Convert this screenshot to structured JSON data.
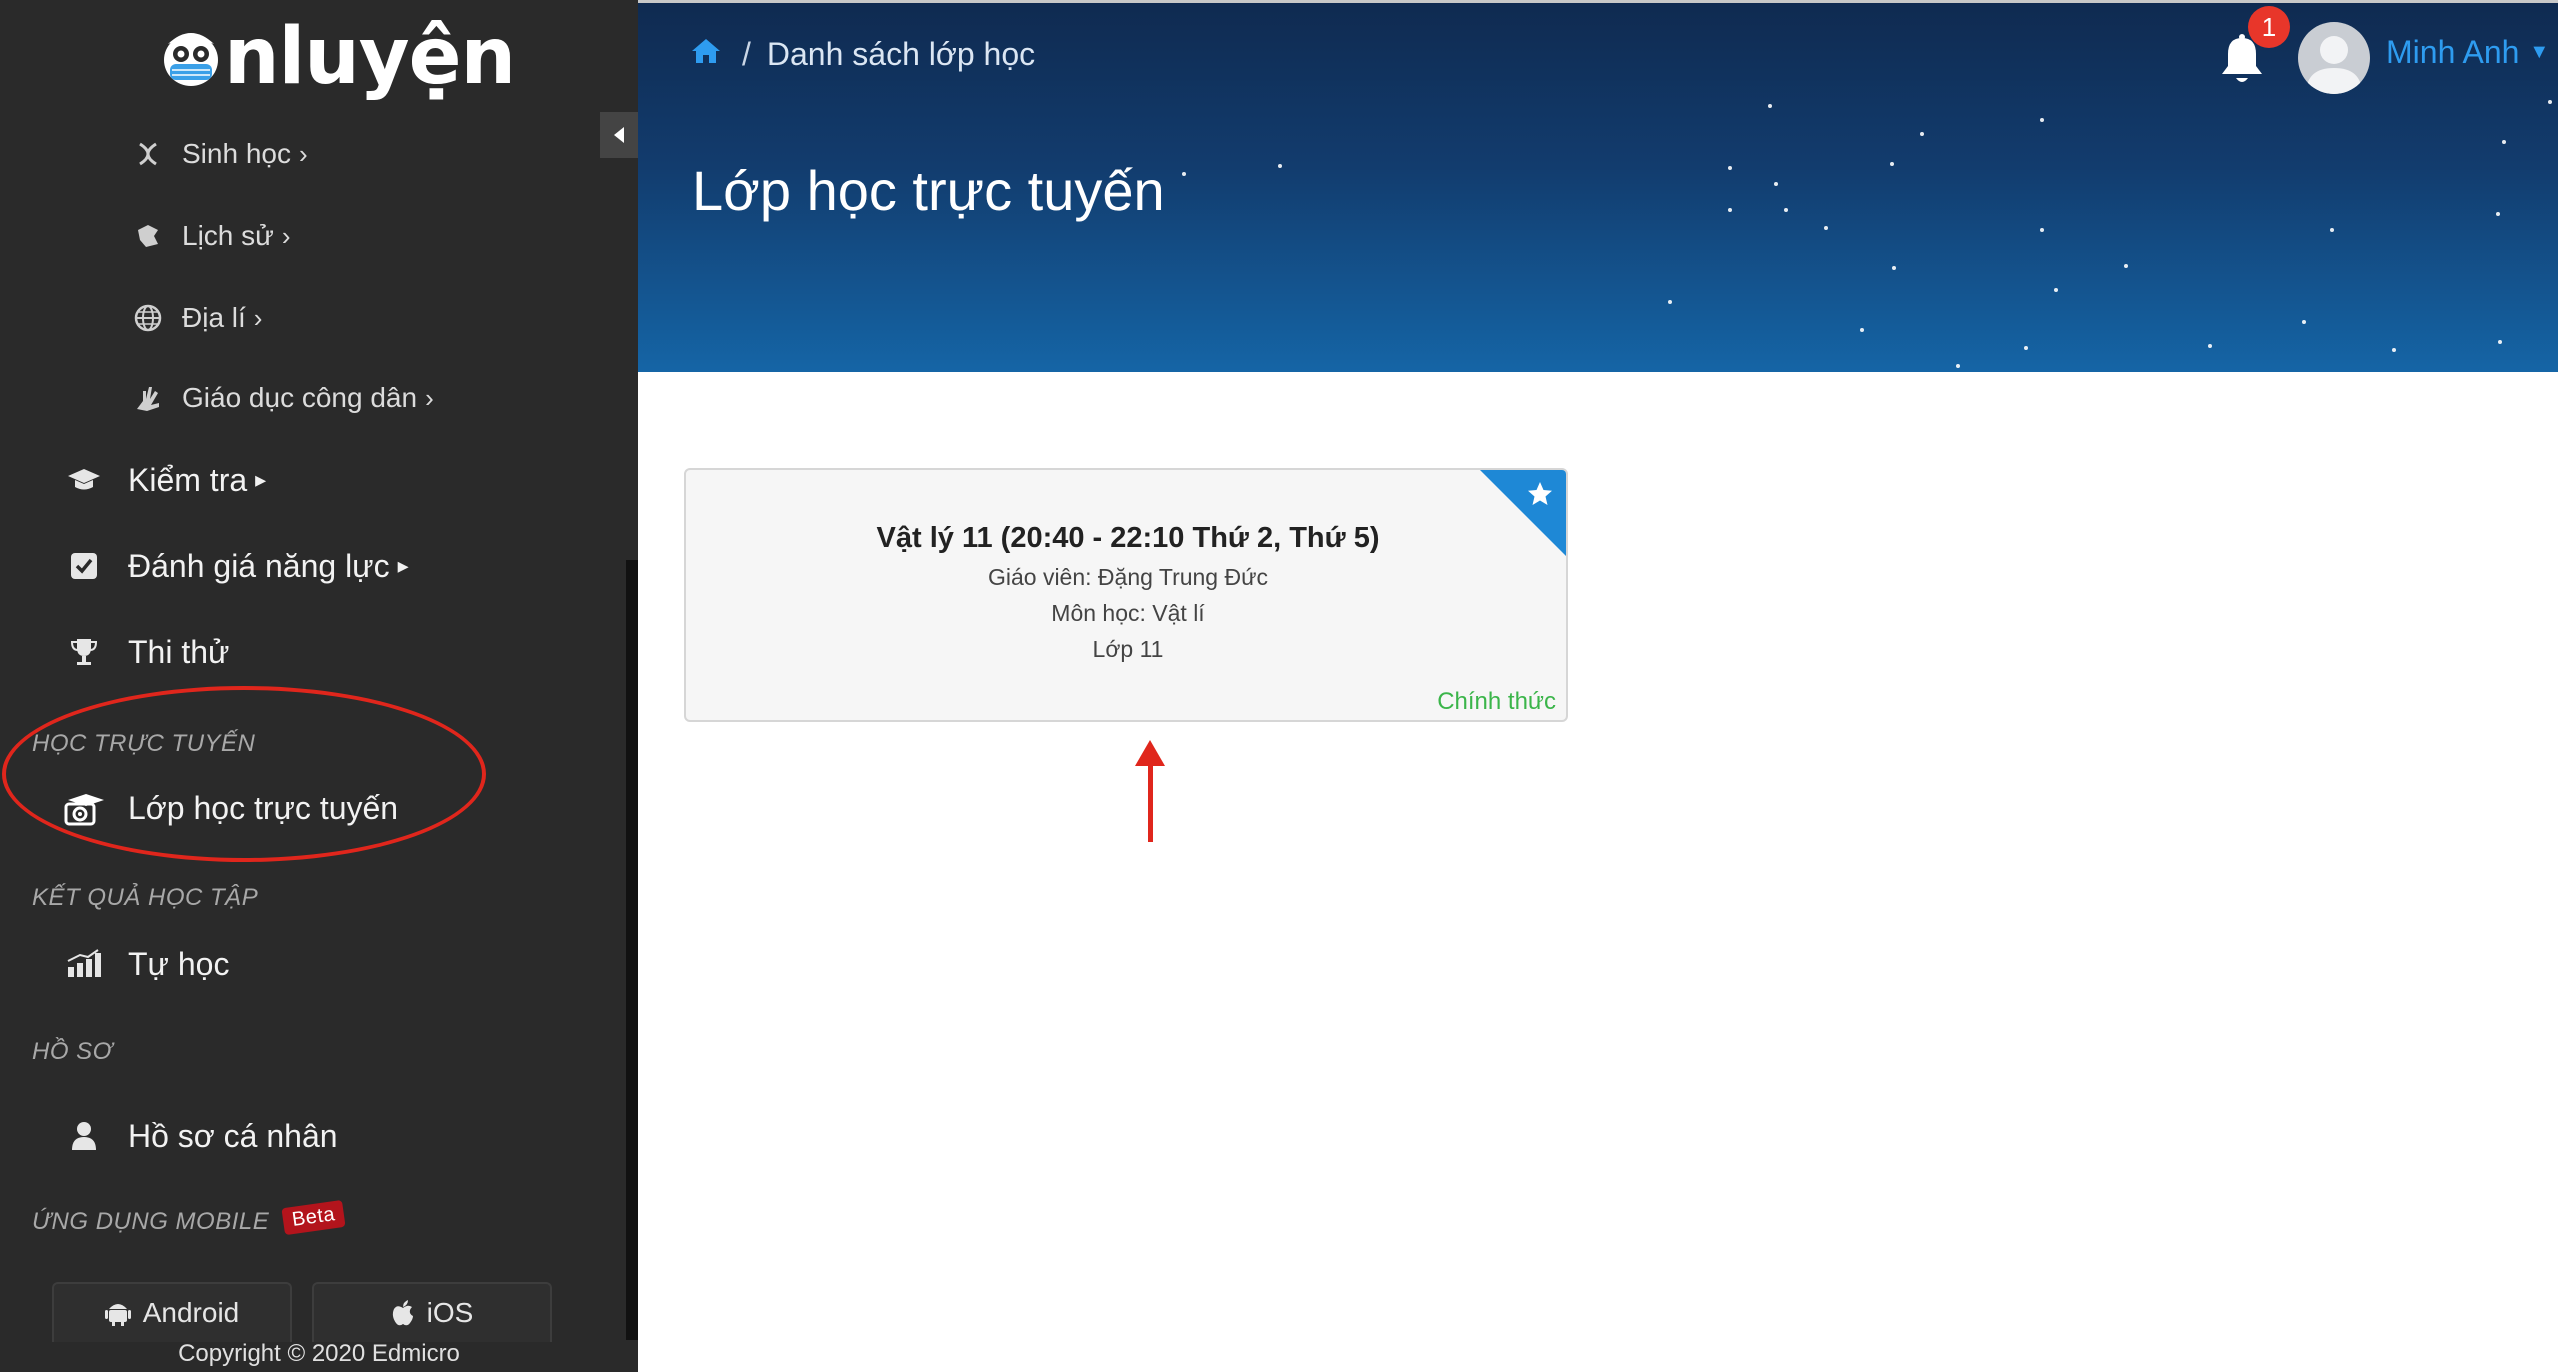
{
  "brand": {
    "logo_text": "nluyện"
  },
  "sidebar": {
    "sub_items": [
      {
        "label": "Sinh học",
        "icon": "dna-icon"
      },
      {
        "label": "Lịch sử",
        "icon": "scroll-icon"
      },
      {
        "label": "Địa lí",
        "icon": "globe-icon"
      },
      {
        "label": "Giáo dục công dân",
        "icon": "hand-icon"
      }
    ],
    "main_items": [
      {
        "label": "Kiểm tra",
        "icon": "graduation-cap-icon"
      },
      {
        "label": "Đánh giá năng lực",
        "icon": "checkbox-icon"
      },
      {
        "label": "Thi thử",
        "icon": "trophy-icon"
      }
    ],
    "sections": {
      "online": {
        "title": "HỌC TRỰC TUYẾN",
        "item": "Lớp học trực tuyến"
      },
      "results": {
        "title": "KẾT QUẢ HỌC TẬP",
        "item": "Tự học"
      },
      "profile": {
        "title": "HỒ SƠ",
        "item": "Hồ sơ cá nhân"
      },
      "mobile": {
        "title": "ỨNG DỤNG MOBILE",
        "badge": "Beta"
      }
    },
    "apps": {
      "android": "Android",
      "ios": "iOS"
    },
    "copyright": "Copyright © 2020 Edmicro"
  },
  "header": {
    "breadcrumb": "Danh sách lớp học",
    "title": "Lớp học trực tuyến",
    "notification_count": "1",
    "user_name": "Minh Anh"
  },
  "class_card": {
    "title": "Vật lý 11 (20:40 - 22:10 Thứ 2, Thứ 5)",
    "teacher": "Giáo viên: Đặng Trung Đức",
    "subject": "Môn học: Vật lí",
    "grade": "Lớp 11",
    "status": "Chính thức"
  },
  "colors": {
    "sidebar_bg": "#2a2a2a",
    "header_top": "#0f2a50",
    "header_bottom": "#1565a6",
    "accent_blue": "#2e9cf0",
    "status_green": "#3bb54a",
    "annotation_red": "#e0261c"
  }
}
